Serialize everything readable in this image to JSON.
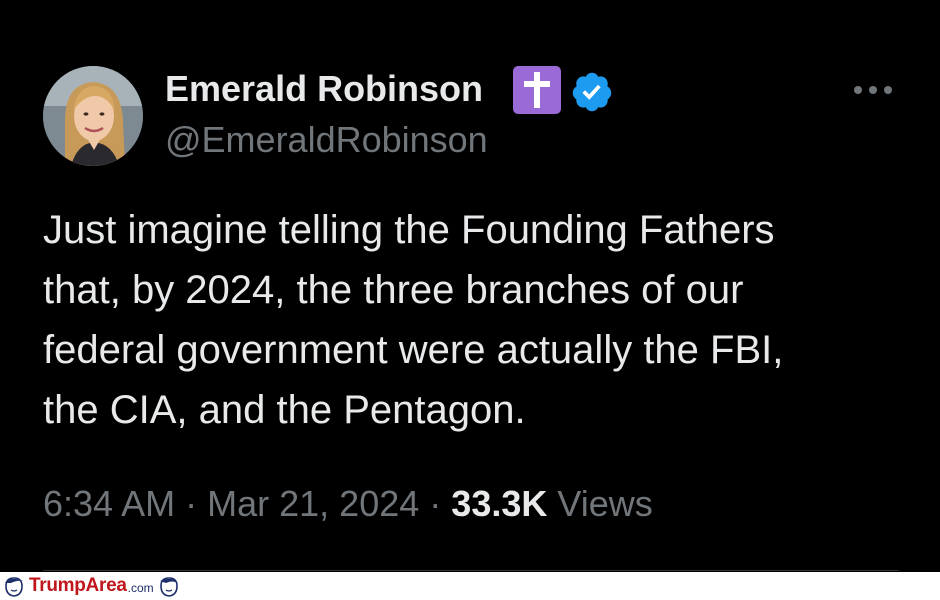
{
  "tweet": {
    "author_name": "Emerald Robinson",
    "author_handle": "@EmeraldRobinson",
    "badges": [
      "cross-emoji-icon",
      "verified-icon"
    ],
    "text_lines": [
      "Just imagine telling the Founding Fathers",
      "that, by 2024, the three branches of our",
      "federal government were actually the FBI,",
      "the CIA, and the Pentagon."
    ],
    "time": "6:34 AM",
    "separator": "·",
    "date": "Mar 21, 2024",
    "views_count": "33.3K",
    "views_label": "Views",
    "more_icon": "more-horizontal-icon"
  },
  "watermark": {
    "brand": "TrumpArea",
    "suffix": ".com",
    "icon": "trump-face-icon"
  },
  "colors": {
    "background": "#000000",
    "text_primary": "#e7e9ea",
    "text_secondary": "#71767b",
    "verified_blue": "#1d9bf0",
    "cross_badge": "#9a6ad6",
    "watermark_red": "#c0171d"
  }
}
